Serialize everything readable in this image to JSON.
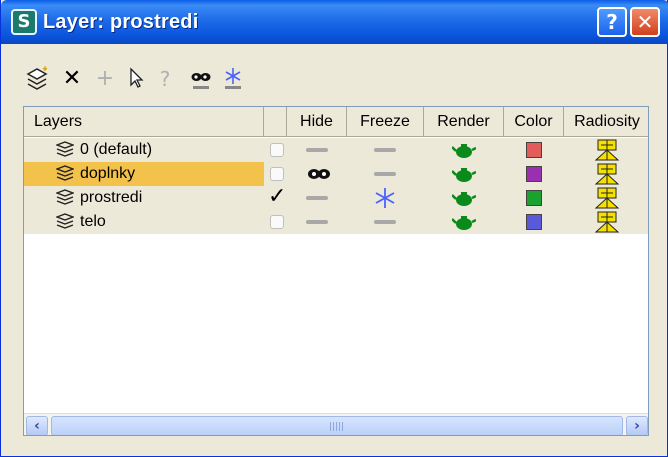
{
  "window": {
    "title": "Layer: prostredi",
    "help_label": "?",
    "close_label": "✕",
    "app_icon_label": "S"
  },
  "toolbar": {
    "tools": [
      {
        "icon": "create-layer-icon",
        "glyph": "☰"
      },
      {
        "icon": "delete-icon",
        "glyph": "✕"
      },
      {
        "icon": "add-to-layer-icon",
        "glyph": "+"
      },
      {
        "icon": "select-objects-icon",
        "glyph": "⇱"
      },
      {
        "icon": "highlight-icon",
        "glyph": "?"
      },
      {
        "icon": "hide-all-icon",
        "glyph": "∞"
      },
      {
        "icon": "freeze-all-icon",
        "glyph": "❄"
      }
    ]
  },
  "table": {
    "columns": {
      "layers": "Layers",
      "hide": "Hide",
      "freeze": "Freeze",
      "render": "Render",
      "color": "Color",
      "radiosity": "Radiosity"
    },
    "rows": [
      {
        "name": "0 (default)",
        "current": false,
        "hidden": false,
        "frozen": false,
        "color": "#e35b5b",
        "selected": false
      },
      {
        "name": "doplnky",
        "current": false,
        "hidden": true,
        "frozen": false,
        "color": "#9a2fb0",
        "selected": true
      },
      {
        "name": "prostredi",
        "current": true,
        "hidden": false,
        "frozen": true,
        "color": "#1aa12f",
        "selected": false
      },
      {
        "name": "telo",
        "current": false,
        "hidden": false,
        "frozen": false,
        "color": "#5a5ad8",
        "selected": false
      }
    ],
    "current_mark": "✓"
  },
  "colors": {
    "selection": "#f3c24b",
    "titlebar": "#0b55dc",
    "render_teapot": "#0a8a1a",
    "radiosity": "#f5e000"
  }
}
